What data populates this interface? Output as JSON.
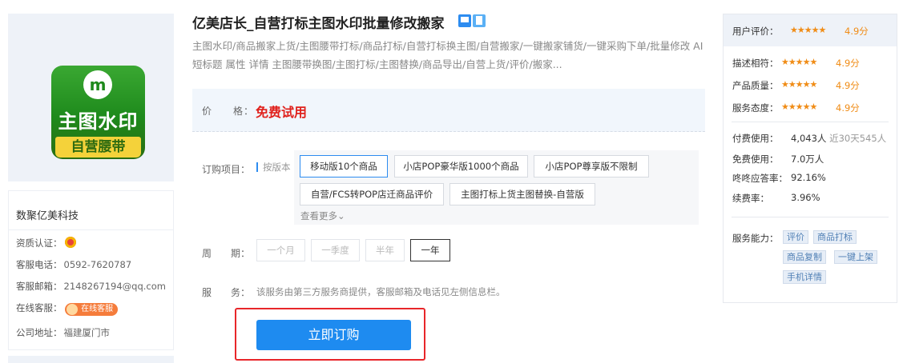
{
  "logo": {
    "glyph": "m",
    "title": "主图水印",
    "band": "自营腰带"
  },
  "company": {
    "name": "数聚亿美科技",
    "qualification_label": "资质认证：",
    "phone_label": "客服电话：",
    "phone": "0592-7620787",
    "email_label": "客服邮箱：",
    "email": "2148267194@qq.com",
    "online_label": "在线客服：",
    "online_badge": "在线客服",
    "address_label": "公司地址：",
    "address": "福建厦门市"
  },
  "product": {
    "title": "亿美店长_自营打标主图水印批量修改搬家",
    "description": "主图水印/商品搬家上货/主图腰带打标/商品打标/自营打标换主图/自营搬家/一键搬家铺货/一键采购下单/批量修改 AI短标题 属性 详情 主图腰带换图/主图打标/主图替换/商品导出/自营上货/评价/搬家..."
  },
  "price": {
    "label": "价　　格：",
    "value": "免费试用"
  },
  "spec": {
    "label": "订购项目：",
    "prefix": "按版本",
    "options": [
      "移动版10个商品",
      "小店POP豪华版1000个商品",
      "小店POP尊享版不限制",
      "自营/FCS转POP店迁商品评价",
      "主图打标上货主图替换-自营版"
    ],
    "selected": "移动版10个商品",
    "more": "查看更多"
  },
  "period": {
    "label": "周　　期：",
    "options": [
      "一个月",
      "一季度",
      "半年",
      "一年"
    ],
    "selected": "一年"
  },
  "service": {
    "label": "服　　务：",
    "note": "该服务由第三方服务商提供，客服邮箱及电话见左侧信息栏。"
  },
  "buy_button": "立即订购",
  "ratings": {
    "user_rating_label": "用户评价：",
    "user_rating": "4.9分",
    "items": [
      {
        "label": "描述相符：",
        "score": "4.9分"
      },
      {
        "label": "产品质量：",
        "score": "4.9分"
      },
      {
        "label": "服务态度：",
        "score": "4.9分"
      }
    ],
    "stars": "★★★★★",
    "stats": [
      {
        "label": "付费使用：",
        "value": "4,043人",
        "sub": "近30天545人"
      },
      {
        "label": "免费使用：",
        "value": "7.0万人",
        "sub": ""
      },
      {
        "label": "咚咚应答率：",
        "value": "92.16%",
        "sub": ""
      },
      {
        "label": "续费率：",
        "value": "3.96%",
        "sub": ""
      }
    ],
    "capability_label": "服务能力：",
    "tags": [
      "评价",
      "商品打标",
      "商品复制",
      "一键上架",
      "手机详情"
    ]
  },
  "colors": {
    "accent": "#1e8bf0",
    "price": "#e0211c",
    "star": "#f08c16",
    "highlight": "#e8262a"
  }
}
